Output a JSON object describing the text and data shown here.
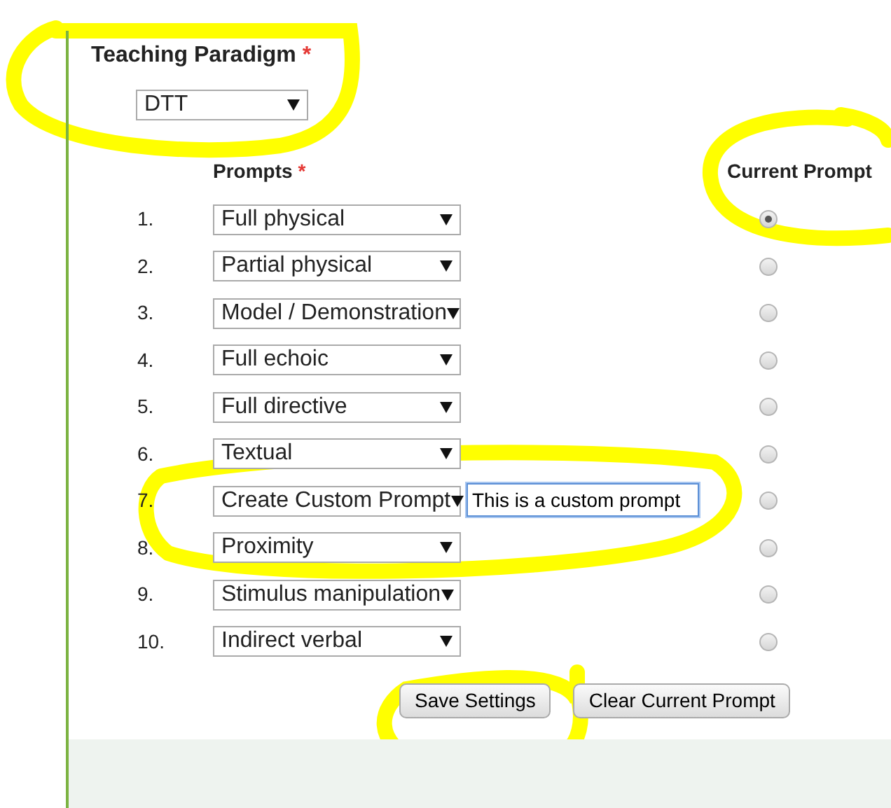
{
  "paradigm": {
    "label": "Teaching Paradigm",
    "required_mark": "*",
    "value": "DTT"
  },
  "prompts_header": {
    "label": "Prompts",
    "required_mark": "*"
  },
  "current_prompt_header": "Current Prompt",
  "prompts": [
    {
      "number": "1.",
      "value": "Full physical",
      "selected": true
    },
    {
      "number": "2.",
      "value": "Partial physical",
      "selected": false
    },
    {
      "number": "3.",
      "value": "Model / Demonstration",
      "selected": false
    },
    {
      "number": "4.",
      "value": "Full echoic",
      "selected": false
    },
    {
      "number": "5.",
      "value": "Full directive",
      "selected": false
    },
    {
      "number": "6.",
      "value": "Textual",
      "selected": false
    },
    {
      "number": "7.",
      "value": "Create Custom Prompt",
      "custom_text": "This is a custom prompt",
      "focused": true,
      "selected": false
    },
    {
      "number": "8.",
      "value": "Proximity",
      "selected": false
    },
    {
      "number": "9.",
      "value": "Stimulus manipulation",
      "selected": false
    },
    {
      "number": "10.",
      "value": "Indirect verbal",
      "selected": false
    }
  ],
  "buttons": [
    {
      "label": "Save Settings"
    },
    {
      "label": "Clear Current Prompt"
    }
  ]
}
